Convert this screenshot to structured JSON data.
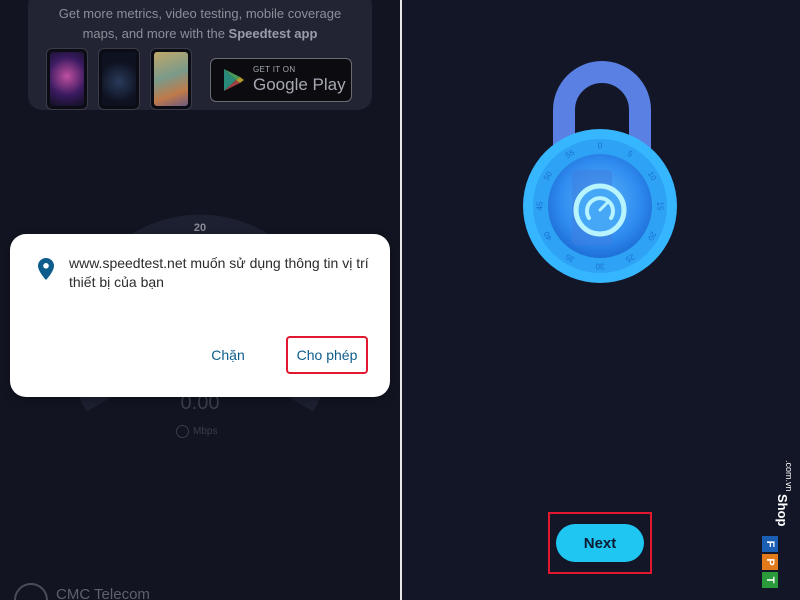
{
  "background_app": {
    "promo_line1": "Get more metrics, video testing, mobile coverage",
    "promo_line2_prefix": "maps, and more with the ",
    "promo_line2_bold": "Speedtest app",
    "store_badge_small": "GET IT ON",
    "store_badge_big": "Google Play",
    "gauge_label": "20",
    "speed_value": "0.00",
    "speed_unit": "Mbps",
    "isp_name": "CMC Telecom"
  },
  "permission_dialog": {
    "message": "www.speedtest.net muốn sử dụng thông tin vị trí thiết bị của bạn",
    "block_label": "Chặn",
    "allow_label": "Cho phép"
  },
  "onboarding": {
    "next_label": "Next",
    "dial_numbers": [
      "0",
      "5",
      "10",
      "15",
      "20",
      "25",
      "30",
      "35",
      "40",
      "45",
      "50",
      "55"
    ]
  },
  "watermark": {
    "brand": "FPT",
    "shop": "Shop",
    "domain": ".com.vn"
  },
  "colors": {
    "accent": "#1fc6f2",
    "highlight": "#e01830",
    "link": "#0e5c8c"
  }
}
